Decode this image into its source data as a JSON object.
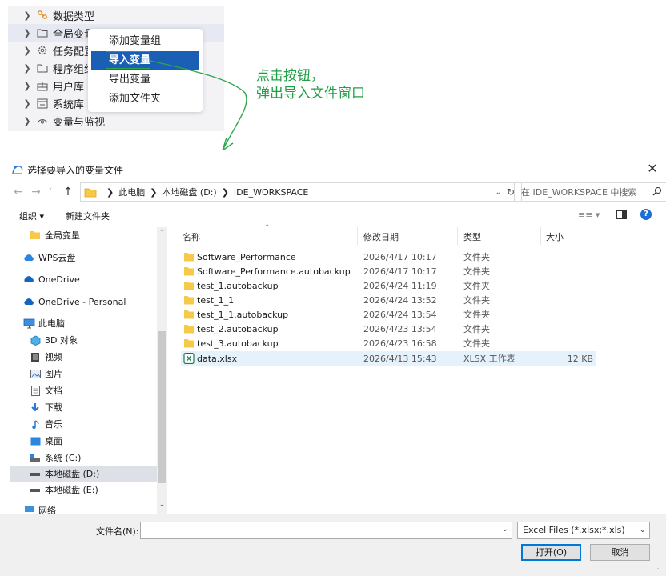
{
  "tree": {
    "items": [
      {
        "label": "数据类型",
        "icon": "data-type-icon"
      },
      {
        "label": "全局变量",
        "icon": "folder-icon"
      },
      {
        "label": "任务配置",
        "icon": "gear-icon"
      },
      {
        "label": "程序组织",
        "icon": "folder-icon"
      },
      {
        "label": "用户库",
        "icon": "library-icon"
      },
      {
        "label": "系统库",
        "icon": "system-library-icon"
      },
      {
        "label": "变量与监视",
        "icon": "eye-icon"
      }
    ]
  },
  "context_menu": {
    "items": [
      "添加变量组",
      "导入变量",
      "导出变量",
      "添加文件夹"
    ],
    "active_index": 1
  },
  "annotation": {
    "line1": "点击按钮，",
    "line2": "弹出导入文件窗口",
    "color": "#22a046"
  },
  "dialog": {
    "title": "选择要导入的变量文件",
    "breadcrumb": [
      "此电脑",
      "本地磁盘 (D:)",
      "IDE_WORKSPACE"
    ],
    "search_placeholder": "在 IDE_WORKSPACE 中搜索",
    "toolbar": {
      "organize": "组织 ▾",
      "new_folder": "新建文件夹"
    },
    "nav": [
      {
        "label": "全局变量",
        "icon": "folder-icon"
      },
      {
        "label": "WPS云盘",
        "icon": "cloud-icon"
      },
      {
        "label": "OneDrive",
        "icon": "cloud-icon"
      },
      {
        "label": "OneDrive - Personal",
        "icon": "cloud-icon"
      },
      {
        "label": "此电脑",
        "icon": "computer-icon"
      },
      {
        "label": "3D 对象",
        "icon": "cube-icon"
      },
      {
        "label": "视频",
        "icon": "video-icon"
      },
      {
        "label": "图片",
        "icon": "picture-icon"
      },
      {
        "label": "文档",
        "icon": "document-icon"
      },
      {
        "label": "下载",
        "icon": "download-icon"
      },
      {
        "label": "音乐",
        "icon": "music-icon"
      },
      {
        "label": "桌面",
        "icon": "desktop-icon"
      },
      {
        "label": "系统 (C:)",
        "icon": "drive-icon"
      },
      {
        "label": "本地磁盘 (D:)",
        "icon": "drive-icon"
      },
      {
        "label": "本地磁盘 (E:)",
        "icon": "drive-icon"
      },
      {
        "label": "网络",
        "icon": "network-icon"
      }
    ],
    "nav_selected": 13,
    "columns": [
      "名称",
      "修改日期",
      "类型",
      "大小"
    ],
    "files": [
      {
        "name": "Software_Performance",
        "date": "2026/4/17 10:17",
        "type": "文件夹",
        "size": ""
      },
      {
        "name": "Software_Performance.autobackup",
        "date": "2026/4/17 10:17",
        "type": "文件夹",
        "size": ""
      },
      {
        "name": "test_1.autobackup",
        "date": "2026/4/24 11:19",
        "type": "文件夹",
        "size": ""
      },
      {
        "name": "test_1_1",
        "date": "2026/4/24 13:52",
        "type": "文件夹",
        "size": ""
      },
      {
        "name": "test_1_1.autobackup",
        "date": "2026/4/24 13:54",
        "type": "文件夹",
        "size": ""
      },
      {
        "name": "test_2.autobackup",
        "date": "2026/4/23 13:54",
        "type": "文件夹",
        "size": ""
      },
      {
        "name": "test_3.autobackup",
        "date": "2026/4/23 16:58",
        "type": "文件夹",
        "size": ""
      },
      {
        "name": "data.xlsx",
        "date": "2026/4/13 15:43",
        "type": "XLSX 工作表",
        "size": "12 KB"
      }
    ],
    "selected_file": 7,
    "filename_label": "文件名(N):",
    "filename_value": "",
    "filter": "Excel Files (*.xlsx;*.xls)",
    "open_label": "打开(O)",
    "cancel_label": "取消"
  }
}
